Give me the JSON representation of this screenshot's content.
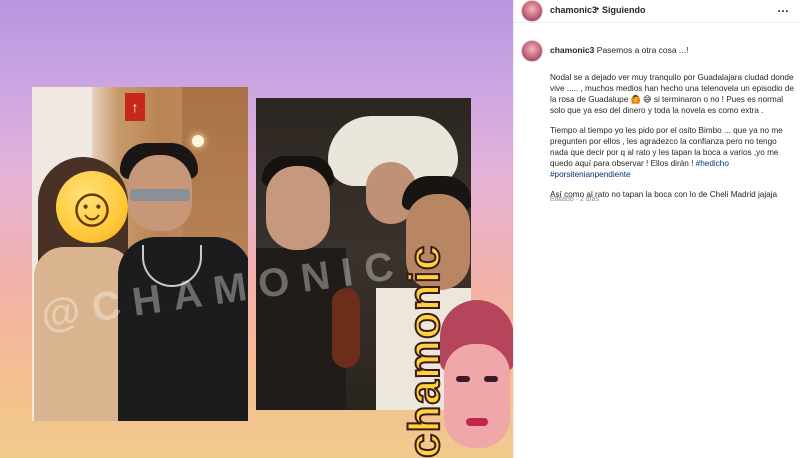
{
  "post": {
    "username": "chamonic3",
    "separator": "•",
    "follow_status": "Siguiendo",
    "more_glyph": "…",
    "caption_first_line": "Pasemos a otra cosa ...!",
    "caption_para1_a": "Nodal se a dejado ver muy tranquilo por Guadalajara ciudad donde vive ..... , muchos medios han hecho una telenovela un episodio de la rosa de Guadalupe 🙆 😅 si terminaron o no ! Pues es normal solo que ya eso del dinero y toda la novela es como extra .",
    "caption_para2_a": "Tiempo al tiempo yo les pido por el osito Bimbo ... que ya no me pregunten por ellos , les agradezco la confianza pero no tengo nada que decir por q al rato y les tapan la boca a varios ,yo me quedo aquí para observar ! Ellos dirán ! ",
    "hashtag1": "#hedicho",
    "hashtag2": "#porsitenianpendiente",
    "caption_para3": "Así como al rato no tapan la boca con lo de Cheli Madrid jajaja",
    "edited_label": "Editado · 2 días"
  },
  "media": {
    "watermark_text": "@CHAMONIC",
    "brand_text": "chamonic",
    "sign_glyph": "↑",
    "emoji": "☺"
  },
  "colors": {
    "hashtag": "#00376b",
    "meta_gray": "#8e8e8e",
    "brand_yellow": "#ffd23c"
  }
}
